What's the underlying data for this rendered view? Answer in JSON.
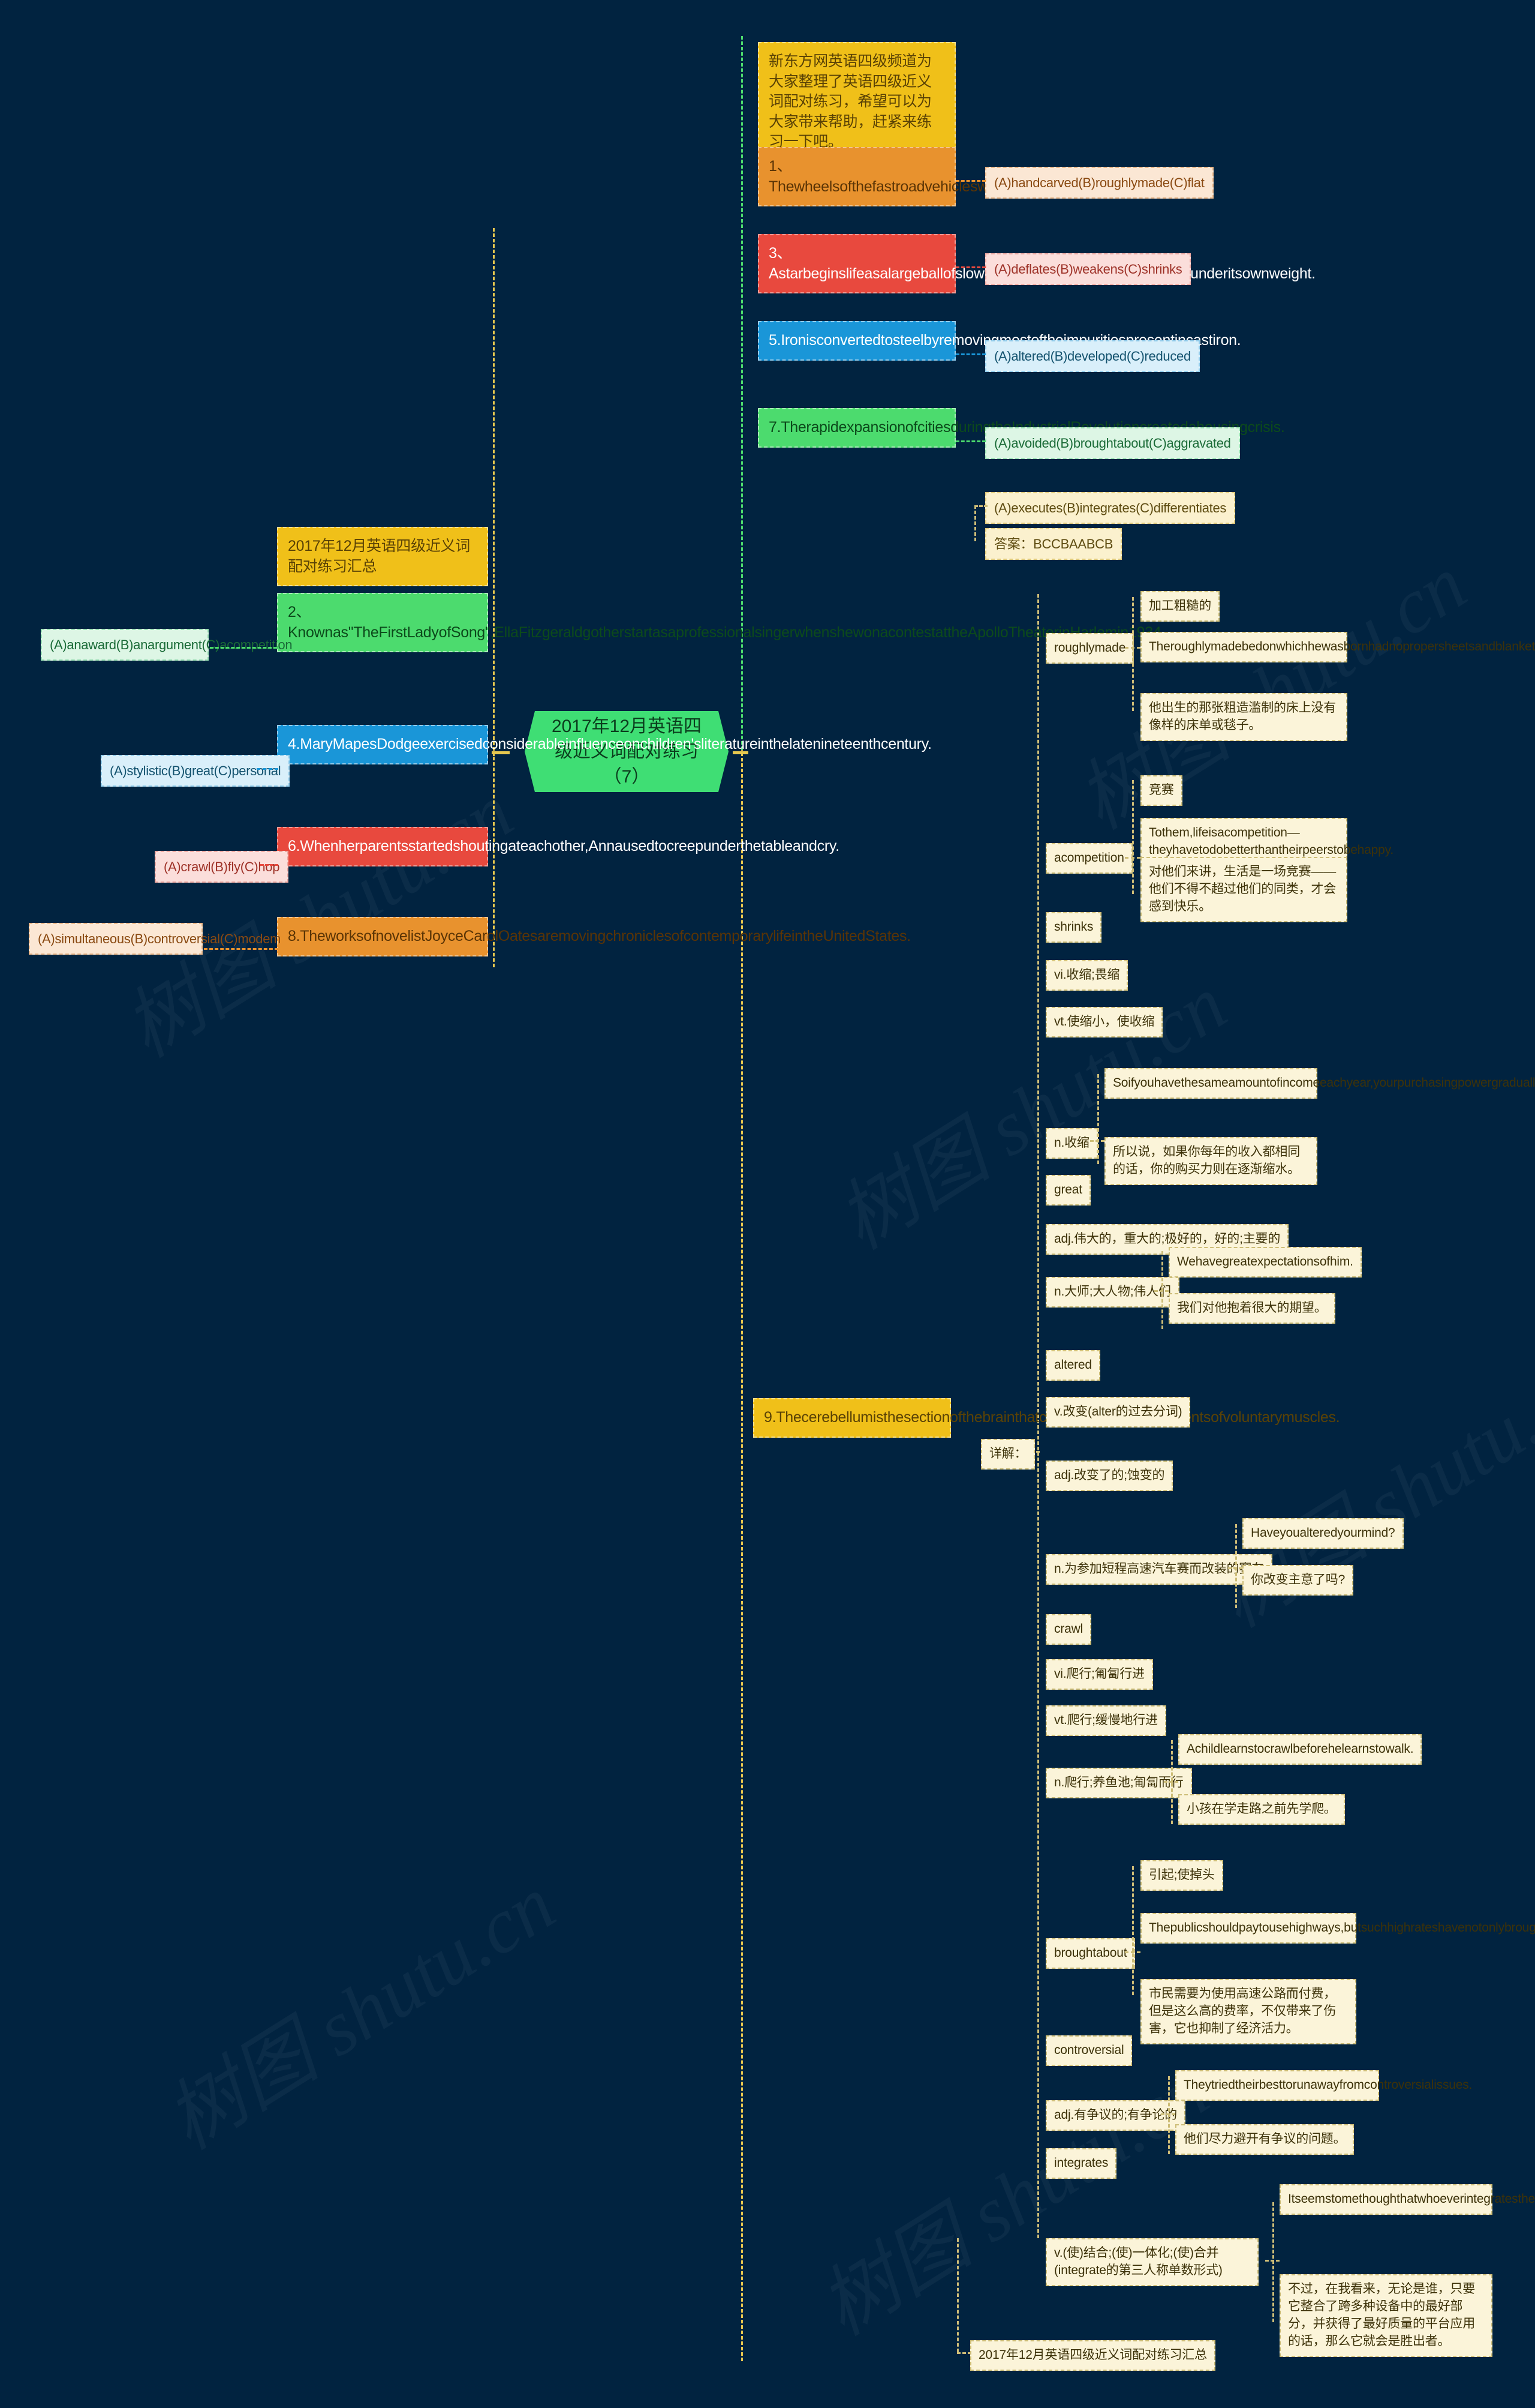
{
  "meta": {
    "background_color": "#012340",
    "watermark": "树图 shutu.cn"
  },
  "center": {
    "title": "2017年12月英语四级近义词配对练习（7）",
    "color": "#3FDE74"
  },
  "left_branch": {
    "nodes": [
      {
        "title": "2017年12月英语四级近义词配对练习汇总",
        "color": "yellow",
        "answer": null
      },
      {
        "title": "2、Knownas\"TheFirstLadyofSong\",EllaFitzgeraldgotherstartasaprofessionalsingerwhenshewonacontestattheApolloTheaterinHarlemin1934.",
        "color": "green",
        "answer": "(A)anaward(B)anargument(C)acompetition"
      },
      {
        "title": "4.MaryMapesDodgeexercisedconsiderableinfluenceonchildren'sliteratureinthelatenineteenthcentury.",
        "color": "blue",
        "answer": "(A)stylistic(B)great(C)personal"
      },
      {
        "title": "6.Whenherparentsstartedshoutingateachother,Annausedtocreepunderthetableandcry.",
        "color": "red",
        "answer": "(A)crawl(B)fly(C)hop"
      },
      {
        "title": "8.TheworksofnovelistJoyceCarolOatesaremovingchroniclesofcontemporarylifeintheUnitedStates.",
        "color": "orange",
        "answer": "(A)simultaneous(B)controversial(C)modem"
      }
    ]
  },
  "right_branch": {
    "intro": "新东方网英语四级频道为大家整理了英语四级近义词配对练习，希望可以为大家带来帮助，赶紧来练习一下吧。",
    "questions": [
      {
        "title": "1、Thewheelsofthefastroadvehicleswerefashionedfromcrudestonedisks.",
        "color": "orange",
        "answer": "(A)handcarved(B)roughlymade(C)flat"
      },
      {
        "title": "3、Astarbeginslifeasalargeballofslowlyrotatinggasthatcontractsslowlyunderitsownweight.",
        "color": "red",
        "answer": "(A)deflates(B)weakens(C)shrinks"
      },
      {
        "title": "5.Ironisconvertedtosteelbyremovingmostoftheimpuritiespresentincastiron.",
        "color": "blue",
        "answer": "(A)altered(B)developed(C)reduced"
      },
      {
        "title": "7.TherapidexpansionofcitiesduringtheIndustrialRevolutioncreatedahousingcrisis.",
        "color": "green",
        "answer": "(A)avoided(B)broughtabout(C)aggravated"
      }
    ],
    "extra_answer": "(A)executes(B)integrates(C)differentiates",
    "answer_key": "答案：BCCBAABCB",
    "question9": {
      "title": "9.Thecerebellumisthesectionofthebrainthatcoordinatesthemovementsofvoluntarymuscles.",
      "color": "yellow"
    },
    "detail_label": "详解：",
    "footer": "2017年12月英语四级近义词配对练习汇总"
  },
  "vocab": [
    {
      "word": "roughlymade",
      "meanings": [
        {
          "gloss": "加工粗糙的",
          "examples": []
        },
        {
          "gloss": "Theroughlymadebedonwhichhewasbornhadnopropersheetsandblankets.",
          "examples": []
        },
        {
          "gloss": "他出生的那张粗造滥制的床上没有像样的床单或毯子。",
          "examples": []
        }
      ]
    },
    {
      "word": "acompetition",
      "meanings": [
        {
          "gloss": "竞赛",
          "examples": []
        },
        {
          "gloss": "Tothem,lifeisacompetition—theyhavetodobetterthantheirpeerstobehappy.",
          "examples": []
        },
        {
          "gloss": "对他们来讲，生活是一场竞赛——他们不得不超过他们的同类，才会感到快乐。",
          "examples": []
        }
      ]
    },
    {
      "word": "shrinks",
      "meanings": [
        {
          "gloss": "vi.收缩;畏缩",
          "examples": []
        },
        {
          "gloss": "vt.使缩小，使收缩",
          "examples": []
        },
        {
          "gloss": "n.收缩",
          "examples": [
            "Soifyouhavethesameamountofincomeeachyear,yourpurchasingpowergraduallyshrinks.",
            "所以说，如果你每年的收入都相同的话，你的购买力则在逐渐缩水。"
          ]
        }
      ]
    },
    {
      "word": "great",
      "meanings": [
        {
          "gloss": "adj.伟大的，重大的;极好的，好的;主要的",
          "examples": []
        },
        {
          "gloss": "n.大师;大人物;伟人们",
          "examples": [
            "Wehavegreatexpectationsofhim.",
            "我们对他抱着很大的期望。"
          ]
        }
      ]
    },
    {
      "word": "altered",
      "meanings": [
        {
          "gloss": "v.改变(alter的过去分词)",
          "examples": []
        },
        {
          "gloss": "adj.改变了的;蚀变的",
          "examples": []
        },
        {
          "gloss": "n.为参加短程高速汽车赛而改装的赛车",
          "examples": [
            "Haveyoualteredyourmind?",
            "你改变主意了吗?"
          ]
        }
      ]
    },
    {
      "word": "crawl",
      "meanings": [
        {
          "gloss": "vi.爬行;匍匐行进",
          "examples": []
        },
        {
          "gloss": "vt.爬行;缓慢地行进",
          "examples": []
        },
        {
          "gloss": "n.爬行;养鱼池;匍匐而行",
          "examples": [
            "Achildlearnstocrawlbeforehelearnstowalk.",
            "小孩在学走路之前先学爬。"
          ]
        }
      ]
    },
    {
      "word": "broughtabout",
      "meanings": [
        {
          "gloss": "引起;使掉头",
          "examples": []
        },
        {
          "gloss": "Thepublicshouldpaytousehighways,butsuchhighrateshavenotonlybroughtaboutsuffering,theyhaveinhibitedeconomicvitality.",
          "examples": []
        },
        {
          "gloss": "市民需要为使用高速公路而付费，但是这么高的费率，不仅带来了伤害，它也抑制了经济活力。",
          "examples": []
        }
      ]
    },
    {
      "word": "controversial",
      "meanings": [
        {
          "gloss": "adj.有争议的;有争论的",
          "examples": [
            "Theytriedtheirbesttorunawayfromcontroversialissues.",
            "他们尽力避开有争议的问题。"
          ]
        }
      ]
    },
    {
      "word": "integrates",
      "meanings": [
        {
          "gloss": "v.(使)结合;(使)一体化;(使)合并(integrate的第三人称单数形式)",
          "examples": [
            "Itseemstomethoughthatwhoeverintegratesthebestacrossmultipledevicesandgetsthehighestqualityapplicationsbuiltfortheirplatformwillbethewinner.",
            "不过，在我看来，无论是谁，只要它整合了跨多种设备中的最好部分，并获得了最好质量的平台应用的话，那么它就会是胜出者。"
          ]
        }
      ]
    }
  ]
}
